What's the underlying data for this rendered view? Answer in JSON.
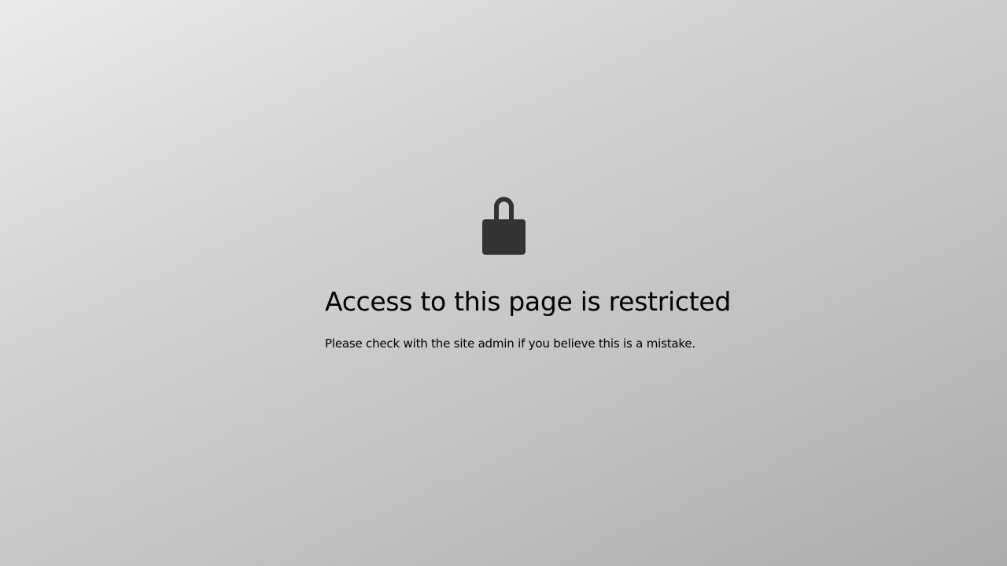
{
  "restricted_notice": {
    "icon": "lock-icon",
    "title": "Access to this page is restricted",
    "message": "Please check with the site admin if you believe this is a mistake."
  },
  "colors": {
    "icon": "#333333",
    "text": "#000000",
    "background_start": "#ebebeb",
    "background_end": "#acacac"
  }
}
